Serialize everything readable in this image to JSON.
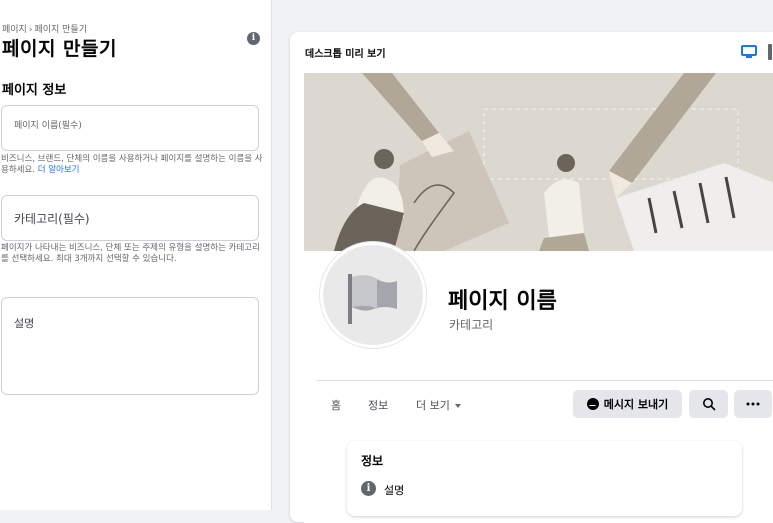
{
  "sidebar": {
    "breadcrumb": [
      "페이지",
      "페이지 만들기"
    ],
    "breadcrumb_sep": "›",
    "title": "페이지 만들기",
    "section_title": "페이지 정보",
    "name_field": {
      "placeholder": "페이지 이름(필수)"
    },
    "name_help": "비즈니스, 브랜드, 단체의 이름을 사용하거나 페이지를 설명하는 이름을 사용하세요.",
    "name_help_link": "더 알아보기",
    "category_field": {
      "placeholder": "카테고리(필수)"
    },
    "category_help": "페이지가 나타내는 비즈니스, 단체 또는 주제의 유형을 설명하는 카테고리를 선택하세요. 최대 3개까지 선택할 수 있습니다.",
    "description_field": {
      "placeholder": "설명"
    }
  },
  "preview": {
    "label": "데스크톱 미리 보기",
    "page_name": "페이지 이름",
    "category": "카테고리",
    "tabs": [
      "홈",
      "정보",
      "더 보기"
    ],
    "message_button": "메시지 보내기",
    "info_card": {
      "title": "정보",
      "description": "설명"
    }
  },
  "colors": {
    "link": "#1877f2",
    "button_bg": "#e4e6eb",
    "desktop_icon": "#1877f2",
    "cover_bg": "#dcd7cf"
  },
  "icons": [
    "info-icon",
    "desktop-icon",
    "mobile-icon",
    "flag-icon",
    "messenger-icon",
    "search-icon",
    "more-icon",
    "caret-down-icon"
  ]
}
